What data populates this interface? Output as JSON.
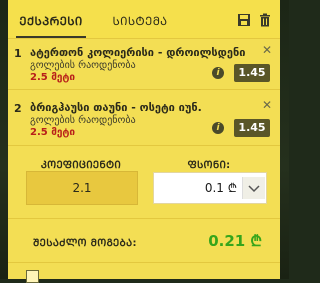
{
  "tabs": {
    "single": "ᲔᲥᲡᲞᲠᲔᲡᲘ",
    "system": "ᲡᲘᲡᲢᲔᲛᲐ"
  },
  "header_icons": [
    "save-icon",
    "trash-icon"
  ],
  "bets": [
    {
      "index": "1",
      "title": "ატერთონ კოლიერისი - დროილსდენი",
      "market": "გოლების რაოდენობა",
      "selection": "2.5 მეტი",
      "odds": "1.45"
    },
    {
      "index": "2",
      "title": "ბრიგჰაუსი თაუნი - ოსეტი იუნ.",
      "market": "გოლების რაოდენობა",
      "selection": "2.5 მეტი",
      "odds": "1.45"
    }
  ],
  "coef_label": "ᲙᲝᲔᲤᲘᲪᲘᲔᲜᲢᲘ",
  "coef_value": "2.1",
  "stake_label": "ᲤᲡᲝᲜᲘ:",
  "stake_value": "0.1 ₾",
  "total_label": "ᲨᲔᲡᲐᲫᲚᲝ ᲛᲝᲒᲔᲑᲐ:",
  "total_value": "0.21 ₾",
  "colors": {
    "panel": "#f3de54",
    "odds_bg": "#5a5628",
    "selection_text": "#b8201a",
    "total_text": "#36a51b"
  }
}
